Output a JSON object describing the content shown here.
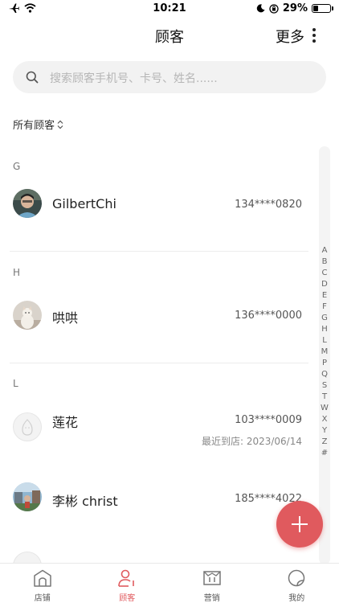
{
  "status_bar": {
    "time": "10:21",
    "battery": "29%",
    "battery_level": 0.29
  },
  "nav": {
    "title": "顾客",
    "more_label": "更多"
  },
  "search": {
    "placeholder": "搜索顾客手机号、卡号、姓名......"
  },
  "filter": {
    "label": "所有顾客"
  },
  "groups": [
    {
      "letter": "G",
      "customers": [
        {
          "name": "GilbertChi",
          "phone": "134****0820",
          "avatar": "photo-avatar"
        }
      ]
    },
    {
      "letter": "H",
      "customers": [
        {
          "name": "哄哄",
          "phone": "136****0000",
          "avatar": "cat-avatar"
        }
      ]
    },
    {
      "letter": "L",
      "customers": [
        {
          "name": "莲花",
          "phone": "103****0009",
          "last_visit_label": "最近到店: 2023/06/14",
          "avatar": "default-avatar"
        },
        {
          "name": "李彬 christ",
          "phone": "185****4022",
          "avatar": "photo-avatar"
        }
      ]
    }
  ],
  "index_letters": [
    "A",
    "B",
    "C",
    "D",
    "E",
    "F",
    "G",
    "H",
    "L",
    "M",
    "P",
    "Q",
    "S",
    "T",
    "W",
    "X",
    "Y",
    "Z",
    "#"
  ],
  "tabs": [
    {
      "label": "店铺",
      "icon": "store-icon",
      "active": false
    },
    {
      "label": "顾客",
      "icon": "customer-icon",
      "active": true
    },
    {
      "label": "营销",
      "icon": "marketing-icon",
      "active": false
    },
    {
      "label": "我的",
      "icon": "profile-icon",
      "active": false
    }
  ],
  "colors": {
    "accent": "#e05a5e",
    "search_bg": "#f2f2f2"
  }
}
